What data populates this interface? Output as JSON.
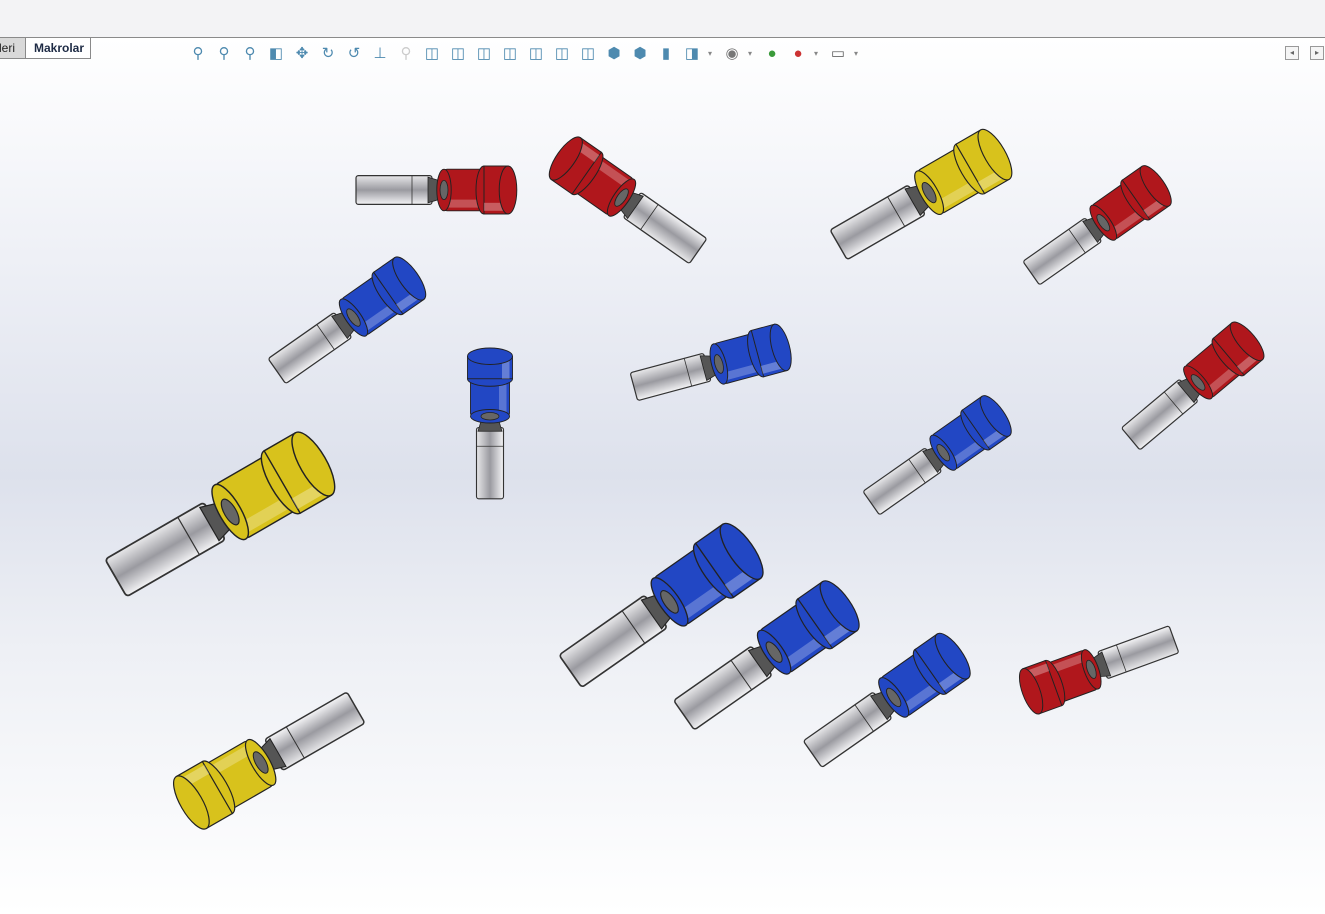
{
  "tabs": [
    {
      "label": "leri"
    },
    {
      "label": "Makrolar"
    }
  ],
  "toolbar": {
    "icons": [
      "zoom-to-fit-icon",
      "zoom-to-area-icon",
      "zoom-in-out-icon",
      "section-view-icon",
      "pan-icon",
      "rotate-icon",
      "roll-view-icon",
      "normal-to-icon",
      "zoom-to-selection-icon",
      "isometric-view-icon",
      "front-view-icon",
      "back-view-icon",
      "left-view-icon",
      "right-view-icon",
      "top-view-icon",
      "bottom-view-icon",
      "shaded-icon",
      "shaded-edges-icon",
      "hidden-lines-icon",
      "display-style-icon",
      "hide-show-icon",
      "edit-appearance-icon",
      "apply-scene-icon",
      "view-settings-icon"
    ]
  },
  "colors": {
    "red": "#b0171c",
    "blue": "#2247c4",
    "yellow": "#d8c21c",
    "metal": "#c9c9cc"
  },
  "connectors": [
    {
      "color": "red"
    },
    {
      "color": "red"
    },
    {
      "color": "yellow"
    },
    {
      "color": "red"
    },
    {
      "color": "blue"
    },
    {
      "color": "blue"
    },
    {
      "color": "blue"
    },
    {
      "color": "red"
    },
    {
      "color": "blue"
    },
    {
      "color": "yellow"
    },
    {
      "color": "blue"
    },
    {
      "color": "blue"
    },
    {
      "color": "blue"
    },
    {
      "color": "red"
    },
    {
      "color": "yellow"
    }
  ]
}
